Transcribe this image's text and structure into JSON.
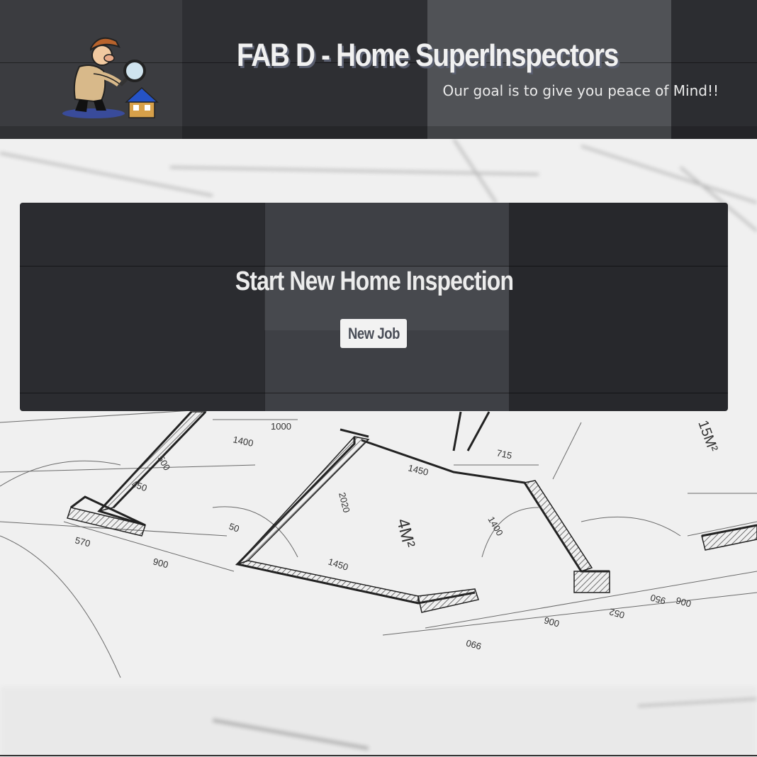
{
  "header": {
    "title": "FAB D - Home SuperInspectors",
    "tagline": "Our goal is to give you peace of Mind!!",
    "mascot_icon": "detective-with-magnifier-and-house-icon"
  },
  "main": {
    "card_title": "Start New Home Inspection",
    "new_job_label": "New Job"
  },
  "blueprint": {
    "dimension_labels": [
      "1000",
      "1400",
      "715",
      "15M²",
      "1450",
      "2020",
      "4M²",
      "1400",
      "500",
      "50",
      "450",
      "570",
      "900",
      "1450",
      "950",
      "006",
      "990",
      "052",
      "006"
    ]
  },
  "colors": {
    "header_bg": "#2e2f33",
    "card_bg": "#2b2c30",
    "title_shadow": "#5a5f70",
    "button_bg": "#f2f2f2",
    "button_text": "#494d57"
  }
}
